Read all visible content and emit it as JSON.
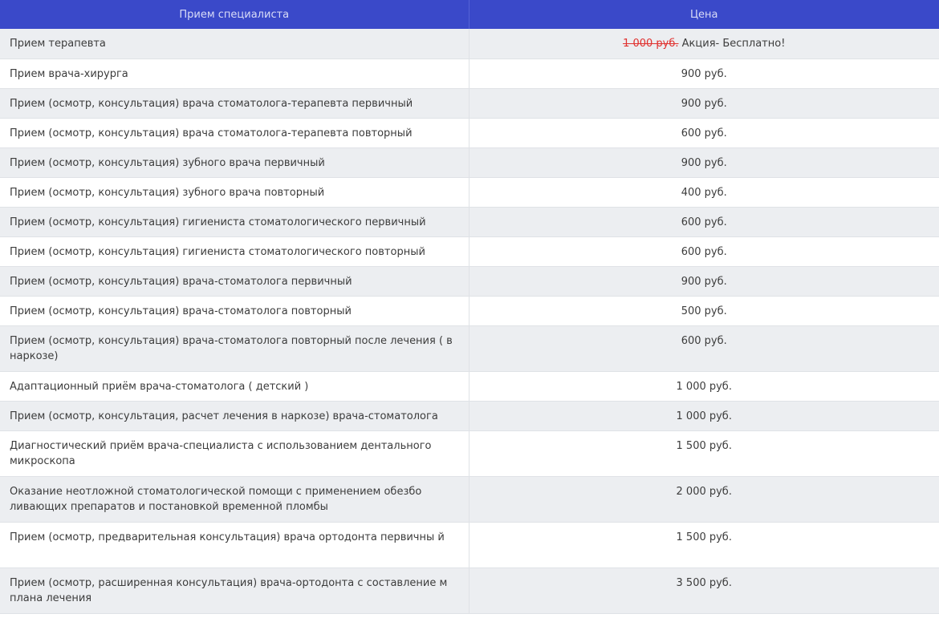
{
  "table": {
    "header": {
      "service": "Прием специалиста",
      "price": "Цена"
    },
    "rows": [
      {
        "service": "Прием терапевта",
        "old_price": "1 000 руб.",
        "price": "Акция- Бесплатно!"
      },
      {
        "service": "Прием  врача-хирурга",
        "price": "900 руб."
      },
      {
        "service": "Прием (осмотр, консультация) врача стоматолога-терапевта первичный",
        "price": "900 руб."
      },
      {
        "service": "Прием (осмотр, консультация) врача стоматолога-терапевта повторный",
        "price": "600 руб."
      },
      {
        "service": "Прием (осмотр, консультация) зубного врача первичный",
        "price": "900 руб."
      },
      {
        "service": "Прием (осмотр, консультация) зубного врача повторный",
        "price": "400 руб."
      },
      {
        "service": "Прием (осмотр, консультация) гигиениста стоматологического первичный",
        "price": "600 руб."
      },
      {
        "service": "Прием (осмотр, консультация) гигиениста стоматологического повторный",
        "price": "600 руб."
      },
      {
        "service": "Прием (осмотр, консультация) врача-стоматолога первичный",
        "price": "900 руб."
      },
      {
        "service": "Прием (осмотр, консультация) врача-стоматолога повторный",
        "price": "500 руб."
      },
      {
        "service": "Прием (осмотр, консультация) врача-стоматолога повторный после лечения ( в наркозе)",
        "price": "600 руб."
      },
      {
        "service": "Адаптационный приём врача-стоматолога ( детский )",
        "price": "1 000 руб."
      },
      {
        "service": "Прием (осмотр, консультация, расчет лечения в наркозе) врача-стоматолога",
        "price": "1 000 руб."
      },
      {
        "service": "Диагностический приём врача-специалиста с использованием дентального микроскопа",
        "price": "1 500 руб."
      },
      {
        "service": "Оказание неотложной стоматологической помощи  с применением обезбо ливающих препаратов  и постановкой временной пломбы",
        "price": "2 000 руб."
      },
      {
        "service": "Прием (осмотр, предварительная консультация) врача ортодонта первичны й",
        "price": "1 500 руб."
      },
      {
        "service": "Прием (осмотр, расширенная консультация) врача-ортодонта с составление м плана лечения",
        "price": "3 500 руб."
      }
    ]
  }
}
